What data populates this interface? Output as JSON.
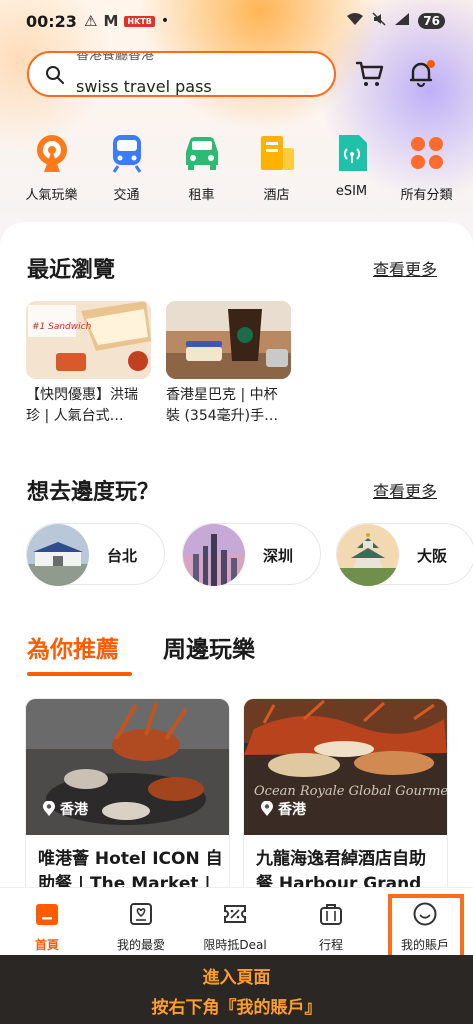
{
  "status_bar": {
    "time": "00:23",
    "app_badge": "HKTB",
    "battery": "76"
  },
  "search": {
    "prev_text": "香港餐廳香港",
    "query": "swiss travel pass"
  },
  "categories": [
    {
      "label": "人氣玩樂",
      "icon": "ferris-wheel-icon",
      "color": "#ff7a1a"
    },
    {
      "label": "交通",
      "icon": "train-icon",
      "color": "#3b7bff"
    },
    {
      "label": "租車",
      "icon": "car-icon",
      "color": "#2dbb73"
    },
    {
      "label": "酒店",
      "icon": "hotel-icon",
      "color": "#ffb300"
    },
    {
      "label": "eSIM",
      "icon": "sim-icon",
      "color": "#1fc1a8"
    },
    {
      "label": "所有分類",
      "icon": "grid-icon",
      "color": "#ff6b2c"
    }
  ],
  "recent": {
    "title": "最近瀏覽",
    "see_more": "查看更多",
    "items": [
      {
        "text": "【快閃優惠】洪瑞珍 | 人氣台式…",
        "img_text": "#1 Sandwich"
      },
      {
        "text": "香港星巴克 | 中杯裝 (354毫升)手…"
      }
    ]
  },
  "destinations": {
    "title": "想去邊度玩？",
    "see_more": "查看更多",
    "cities": [
      "台北",
      "深圳",
      "大阪"
    ]
  },
  "tabs": {
    "recommended": "為你推薦",
    "nearby": "周邊玩樂"
  },
  "deals": [
    {
      "location": "香港",
      "title": "唯港薈 Hotel ICON 自助餐 | The Market |"
    },
    {
      "location": "香港",
      "title": "九龍海逸君綽酒店自助餐 Harbour Grand",
      "img_text": "Ocean Royale Global Gourmet Feast"
    }
  ],
  "bottom_nav": [
    {
      "label": "首頁",
      "icon": "home-icon",
      "active": true
    },
    {
      "label": "我的最愛",
      "icon": "favorite-icon"
    },
    {
      "label": "限時抵Deal",
      "icon": "deal-icon"
    },
    {
      "label": "行程",
      "icon": "trip-icon"
    },
    {
      "label": "我的賬戶",
      "icon": "account-icon"
    }
  ],
  "banner": {
    "line1": "進入頁面",
    "line2": "按右下角『我的賬戶』"
  },
  "colors": {
    "accent": "#ff5b00",
    "highlight": "#ff6d1a",
    "banner_text": "#ff9d2e"
  }
}
